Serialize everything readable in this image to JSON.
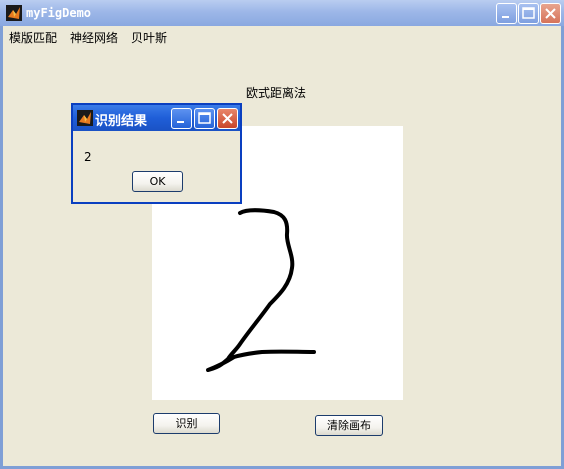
{
  "window": {
    "title": "myFigDemo",
    "icon": "matlab-icon"
  },
  "menu": {
    "items": [
      "模版匹配",
      "神经网络",
      "贝叶斯"
    ]
  },
  "figure": {
    "title": "欧式距离法"
  },
  "buttons": {
    "recognize": "识别",
    "clear": "清除画布"
  },
  "dialog": {
    "title": "识别结果",
    "message": "2",
    "ok_label": "OK",
    "icon": "matlab-icon"
  },
  "colors": {
    "window_bg": "#ece9d8",
    "titlebar_active": "#1f5ed8",
    "titlebar_inactive": "#9db7e8",
    "close_button": "#d6735a",
    "ink": "#000000"
  }
}
